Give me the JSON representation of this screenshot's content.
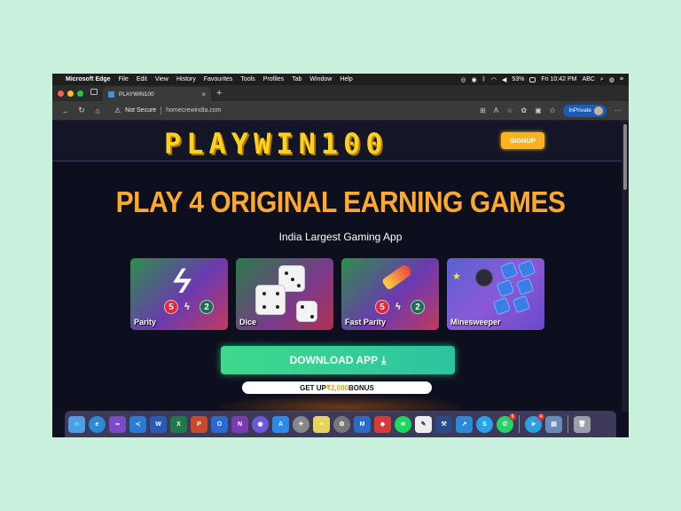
{
  "menubar": {
    "app_name": "Microsoft Edge",
    "items": [
      "File",
      "Edit",
      "View",
      "History",
      "Favourites",
      "Tools",
      "Profiles",
      "Tab",
      "Window",
      "Help"
    ],
    "battery": "53%",
    "clock": "Fri 10:42 PM",
    "input_source": "ABC"
  },
  "tab": {
    "title": "PLAYWIN100",
    "close": "×",
    "new_tab": "+"
  },
  "toolbar": {
    "security_label": "Not Secure",
    "url": "homecrewindia.com",
    "profile_label": "InPrivate"
  },
  "page": {
    "logo": "PLAYWIN100",
    "signup_label": "SIGNUP",
    "headline": "PLAY 4 ORIGINAL EARNING GAMES",
    "subheadline": "India Largest Gaming App",
    "games": [
      {
        "name": "Parity"
      },
      {
        "name": "Dice"
      },
      {
        "name": "Fast Parity"
      },
      {
        "name": "Minesweeper"
      }
    ],
    "badge_five": "5",
    "badge_two": "2",
    "download_label": "DOWNLOAD APP",
    "bonus_prefix": "GET UP ",
    "bonus_amount": "₹2,000",
    "bonus_suffix": " BONUS"
  },
  "dock": {
    "badges": {
      "app_store": "5",
      "telegram": "4"
    }
  },
  "colors": {
    "accent_yellow": "#ffd21f",
    "headline_orange": "#ffa92e",
    "download_green": "#3ed98c",
    "signup_orange": "#ffb21e"
  }
}
